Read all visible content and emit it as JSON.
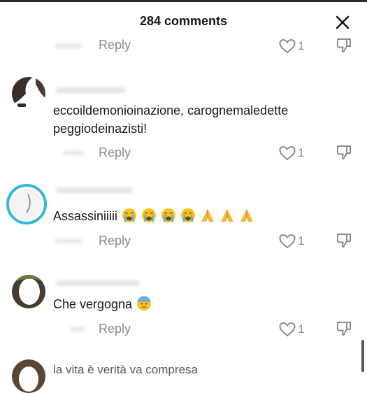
{
  "header": {
    "title": "284 comments"
  },
  "comments": [
    {
      "text": "",
      "reply_label": "Reply",
      "likes": "1"
    },
    {
      "text": "eccoildemonioinazione, carognemaledette peggiodeinazisti!",
      "text_line1": "eccoildemonioinazione, carognemaledette",
      "text_line2": "peggiodeinazisti!",
      "reply_label": "Reply",
      "likes": "1"
    },
    {
      "text": "Assassiniiiii",
      "emojis": [
        "loudly-crying-face",
        "loudly-crying-face",
        "loudly-crying-face",
        "loudly-crying-face",
        "folded-hands",
        "folded-hands",
        "folded-hands"
      ],
      "reply_label": "Reply",
      "likes": "1"
    },
    {
      "text": "Che vergogna",
      "emojis": [
        "downcast-face-with-sweat"
      ],
      "reply_label": "Reply",
      "likes": "1"
    },
    {
      "text": "la vita è verità va compresa"
    }
  ],
  "colors": {
    "text": "#161823",
    "muted": "#8a8b91",
    "avatar_ring": "#35b7d8"
  }
}
